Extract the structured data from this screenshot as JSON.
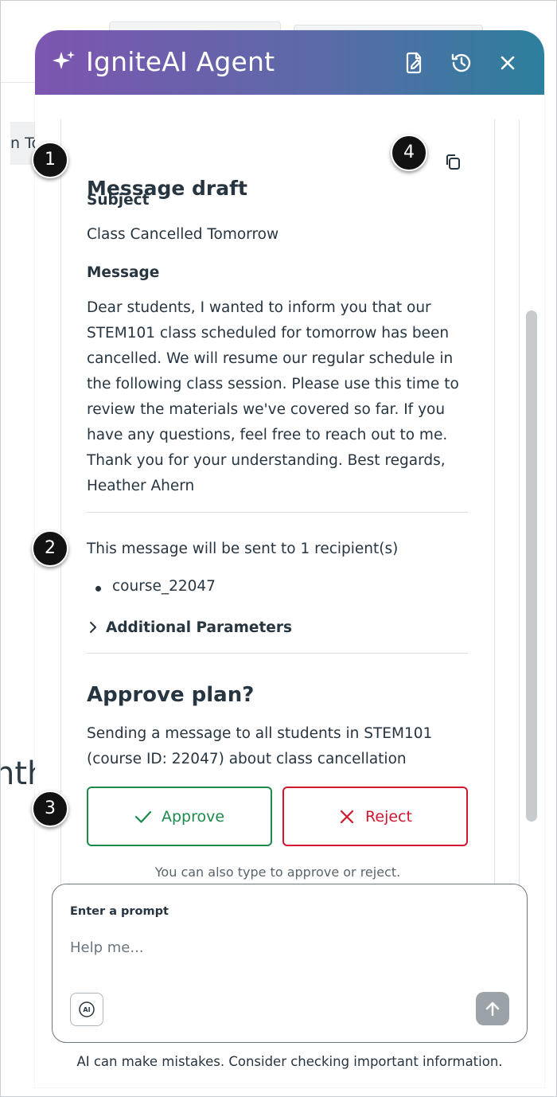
{
  "background": {
    "left_button_partial": "n To",
    "big_text_partial": "nth"
  },
  "header": {
    "title": "IgniteAI Agent",
    "icons": [
      "sparkle-icon",
      "document-edit-icon",
      "history-icon",
      "close-icon"
    ],
    "gradient": [
      "#7d55b0",
      "#2c7f9d"
    ]
  },
  "draft": {
    "title": "Message draft",
    "subject_label": "Subject",
    "subject_value": "Class Cancelled Tomorrow",
    "message_label": "Message",
    "message_lines": [
      "Dear students, I wanted to inform you that our",
      "STEM101 class scheduled for tomorrow has been",
      "cancelled. We will resume our regular schedule in",
      "the following class session. Please use this time to",
      "review the materials we've covered so far. If you",
      "have any questions, feel free to reach out to me.",
      "Thank you for your understanding. Best regards,",
      "Heather Ahern"
    ],
    "recipients_text": "This message will be sent to 1 recipient(s)",
    "recipients": [
      "course_22047"
    ],
    "additional_parameters": "Additional Parameters"
  },
  "approval": {
    "title": "Approve plan?",
    "description_lines": [
      "Sending a message to all students in STEM101",
      "(course ID: 22047) about class cancellation"
    ],
    "approve_label": "Approve",
    "reject_label": "Reject",
    "hint": "You can also type to approve or reject.",
    "approve_color": "#1c8a4a",
    "reject_color": "#d3162f"
  },
  "prompt": {
    "label": "Enter a prompt",
    "placeholder": "Help me...",
    "ai_badge": "AI"
  },
  "footer_note": "AI can make mistakes. Consider checking important information.",
  "callouts": [
    "1",
    "2",
    "3",
    "4"
  ]
}
